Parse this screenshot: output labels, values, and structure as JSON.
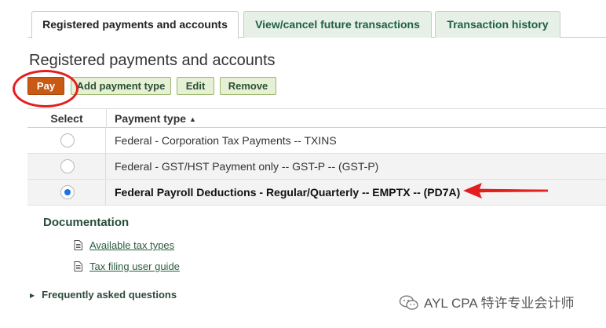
{
  "tabs": [
    {
      "label": "Registered payments and accounts",
      "active": true
    },
    {
      "label": "View/cancel future transactions",
      "active": false
    },
    {
      "label": "Transaction history",
      "active": false
    }
  ],
  "page_title": "Registered payments and accounts",
  "toolbar": {
    "pay_label": "Pay",
    "add_payment_type_label": "Add payment type",
    "edit_label": "Edit",
    "remove_label": "Remove"
  },
  "table": {
    "columns": [
      "Select",
      "Payment type"
    ],
    "sort_indicator": "▲",
    "rows": [
      {
        "payment_type": "Federal - Corporation Tax Payments -- TXINS",
        "selected": false
      },
      {
        "payment_type": "Federal - GST/HST Payment only -- GST-P -- (GST-P)",
        "selected": false
      },
      {
        "payment_type": "Federal Payroll Deductions - Regular/Quarterly -- EMPTX -- (PD7A)",
        "selected": true
      }
    ]
  },
  "documentation": {
    "title": "Documentation",
    "links": [
      "Available tax types",
      "Tax filing user guide"
    ]
  },
  "faq_label": "Frequently asked questions",
  "watermark": "AYL CPA 特许专业会计师",
  "colors": {
    "pay_button": "#c85a13",
    "secondary_button": "#e6f0d4",
    "inactive_tab": "#e6f0e6",
    "annotation": "#e31e1e",
    "radio_selected": "#1a73e8"
  },
  "icons": [
    "document-icon",
    "expand-triangle-icon",
    "wechat-icon",
    "sort-ascending-icon"
  ]
}
